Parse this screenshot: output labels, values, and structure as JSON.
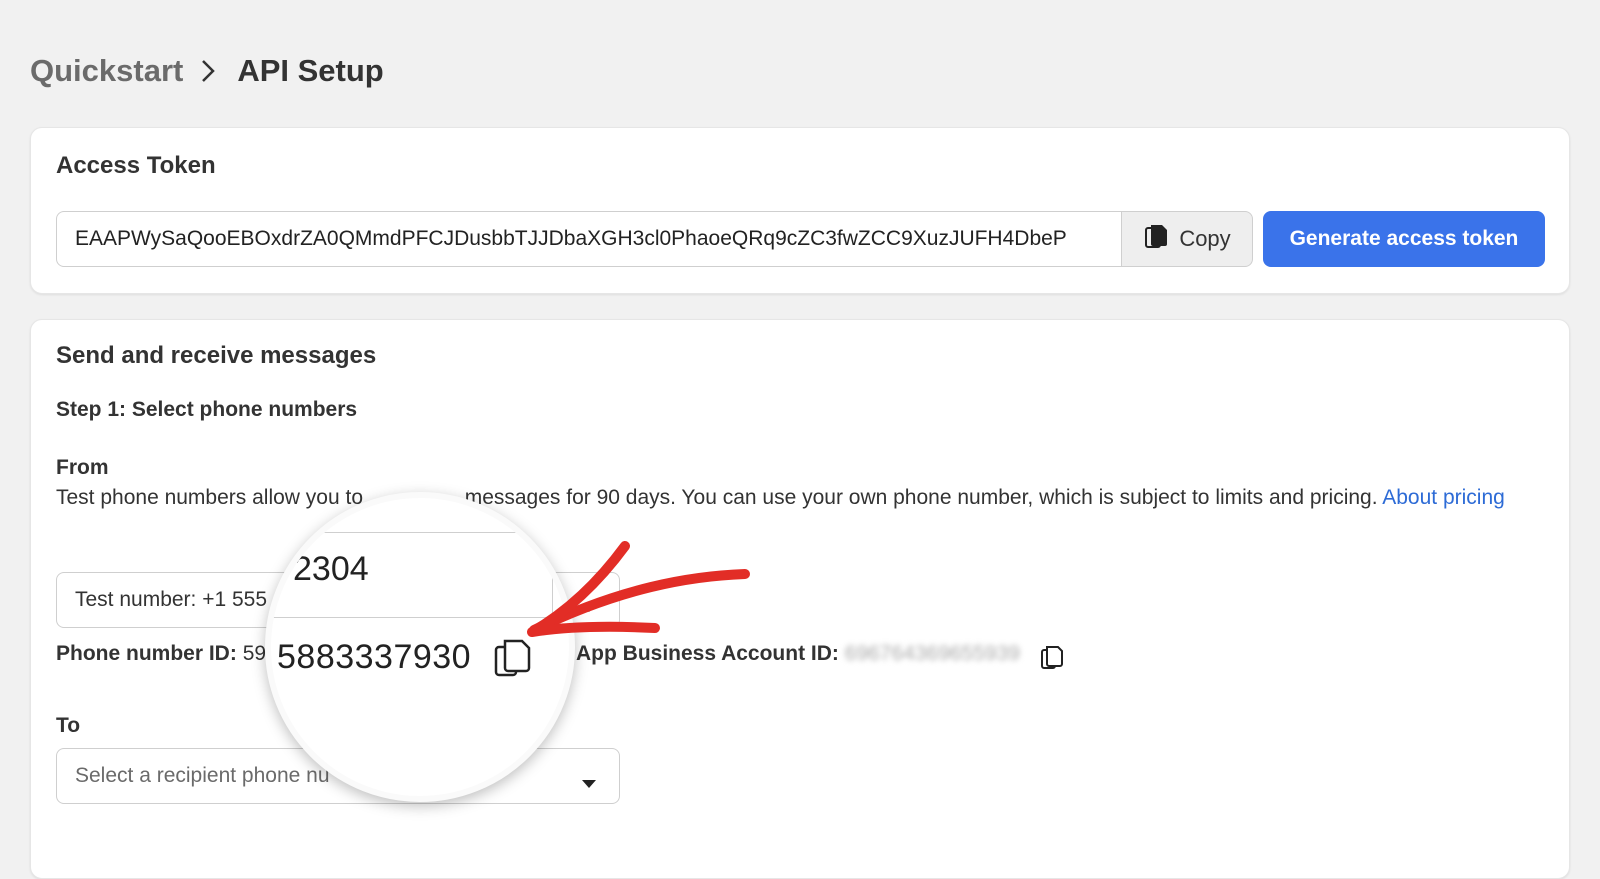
{
  "breadcrumb": {
    "root": "Quickstart",
    "current": "API Setup"
  },
  "access_token": {
    "title": "Access Token",
    "token_value": "EAAPWySaQooEBOxdrZA0QMmdPFCJDusbbTJJDbaXGH3cl0PhaoeQRq9cZC3fwZCC9XuzJUFH4DbeP",
    "copy_label": "Copy",
    "generate_label": "Generate access token"
  },
  "messages": {
    "title": "Send and receive messages",
    "step1": "Step 1: Select phone numbers",
    "from_label": "From",
    "from_desc_a": "Test phone numbers allow you to",
    "from_desc_b": "messages for 90 days. You can use your own phone number, which is subject to limits and pricing.",
    "about_link": "About pricing",
    "from_select_value": "Test number: +1 555",
    "phone_id_label": "Phone number ID:",
    "phone_id_visible": "59",
    "waba_label": "App Business Account ID:",
    "waba_value": "696764369655939",
    "to_label": "To",
    "to_placeholder": "Select a recipient phone nu"
  },
  "magnifier": {
    "line1": "2304",
    "line2": "5883337930"
  },
  "colors": {
    "accent": "#3a73ea",
    "link": "#2d6bd6",
    "arrow": "#e22d26"
  }
}
